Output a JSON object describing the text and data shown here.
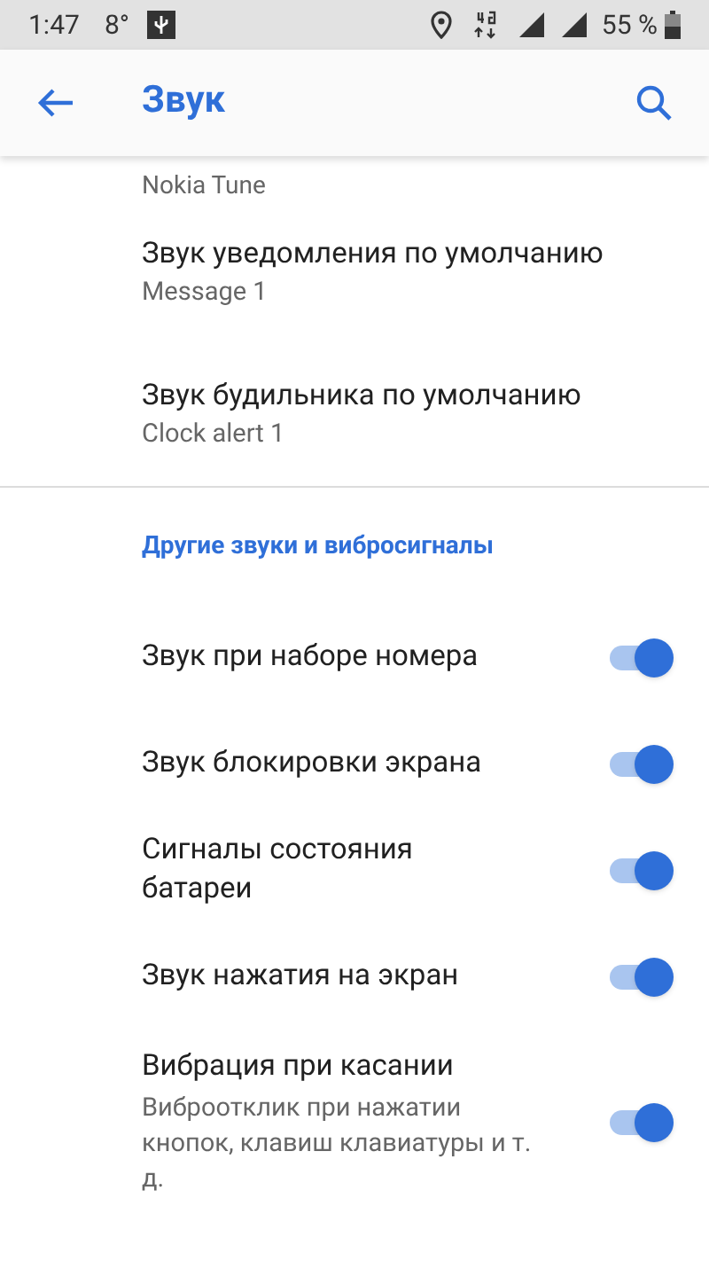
{
  "status_bar": {
    "time": "1:47",
    "temperature": "8°",
    "battery": "55 %"
  },
  "app_bar": {
    "title": "Звук"
  },
  "cut_item": {
    "subtitle": "Nokia Tune"
  },
  "items": [
    {
      "title": "Звук уведомления по умолчанию",
      "subtitle": "Message 1"
    },
    {
      "title": "Звук будильника по умолчанию",
      "subtitle": "Clock alert 1"
    }
  ],
  "section": {
    "title": "Другие звуки и вибросигналы",
    "toggles": [
      {
        "title": "Звук при наборе номера",
        "on": true
      },
      {
        "title": "Звук блокировки экрана",
        "on": true
      },
      {
        "title": "Сигналы состояния батареи",
        "on": true
      },
      {
        "title": "Звук нажатия на экран",
        "on": true
      },
      {
        "title": "Вибрация при касании",
        "subtitle": "Виброотклик при нажатии кнопок, клавиш клавиатуры и т. д.",
        "on": true
      }
    ]
  }
}
